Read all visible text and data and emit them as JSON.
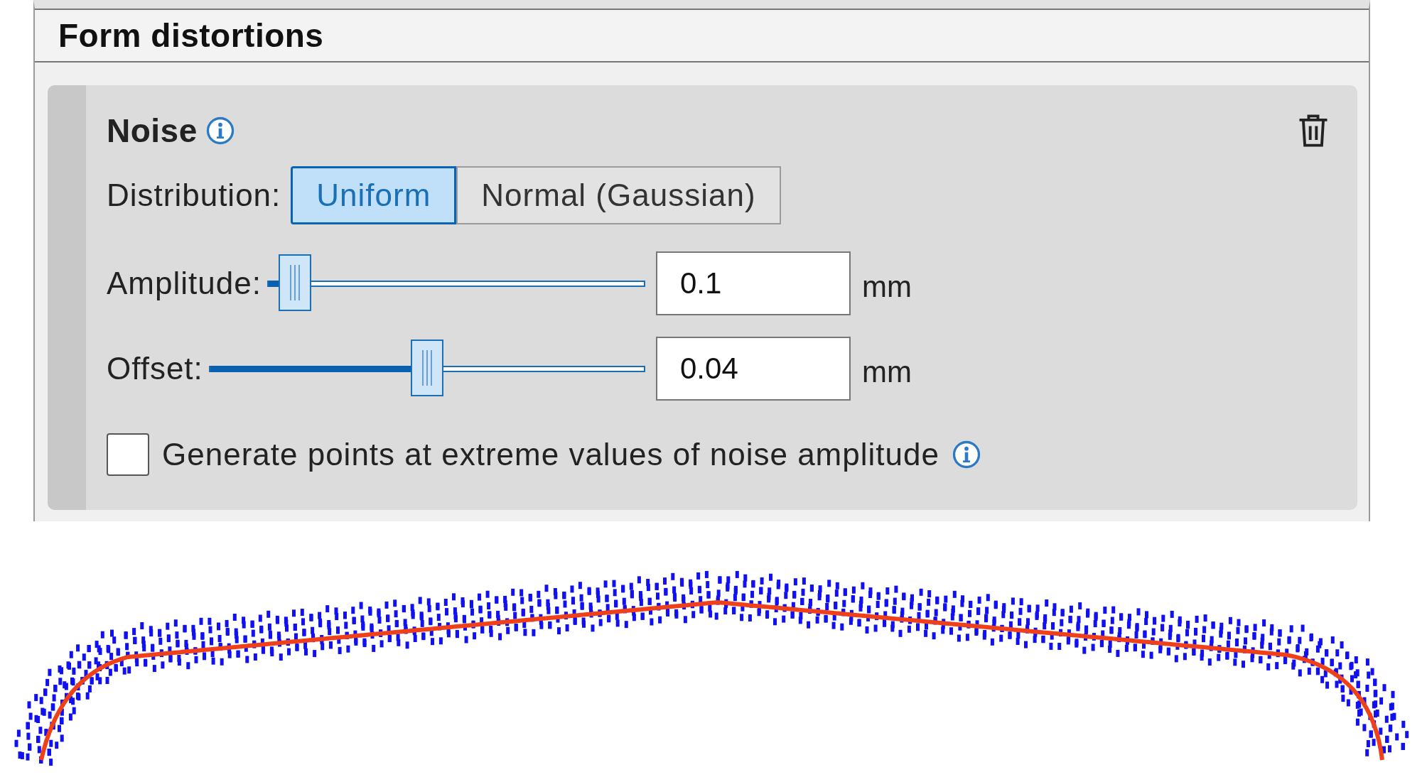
{
  "section": {
    "title": "Form distortions"
  },
  "distortion": {
    "title": "Noise",
    "distribution": {
      "label": "Distribution:",
      "options": [
        {
          "label": "Uniform",
          "selected": true
        },
        {
          "label": "Normal (Gaussian)",
          "selected": false
        }
      ]
    },
    "sliders": [
      {
        "label": "Amplitude:",
        "level": 0.07,
        "value": "0.1",
        "unit": "mm"
      },
      {
        "label": "Offset:",
        "level": 0.5,
        "value": "0.04",
        "unit": "mm"
      }
    ],
    "extreme_points": {
      "label": "Generate points at extreme values of noise amplitude",
      "checked": false
    }
  }
}
